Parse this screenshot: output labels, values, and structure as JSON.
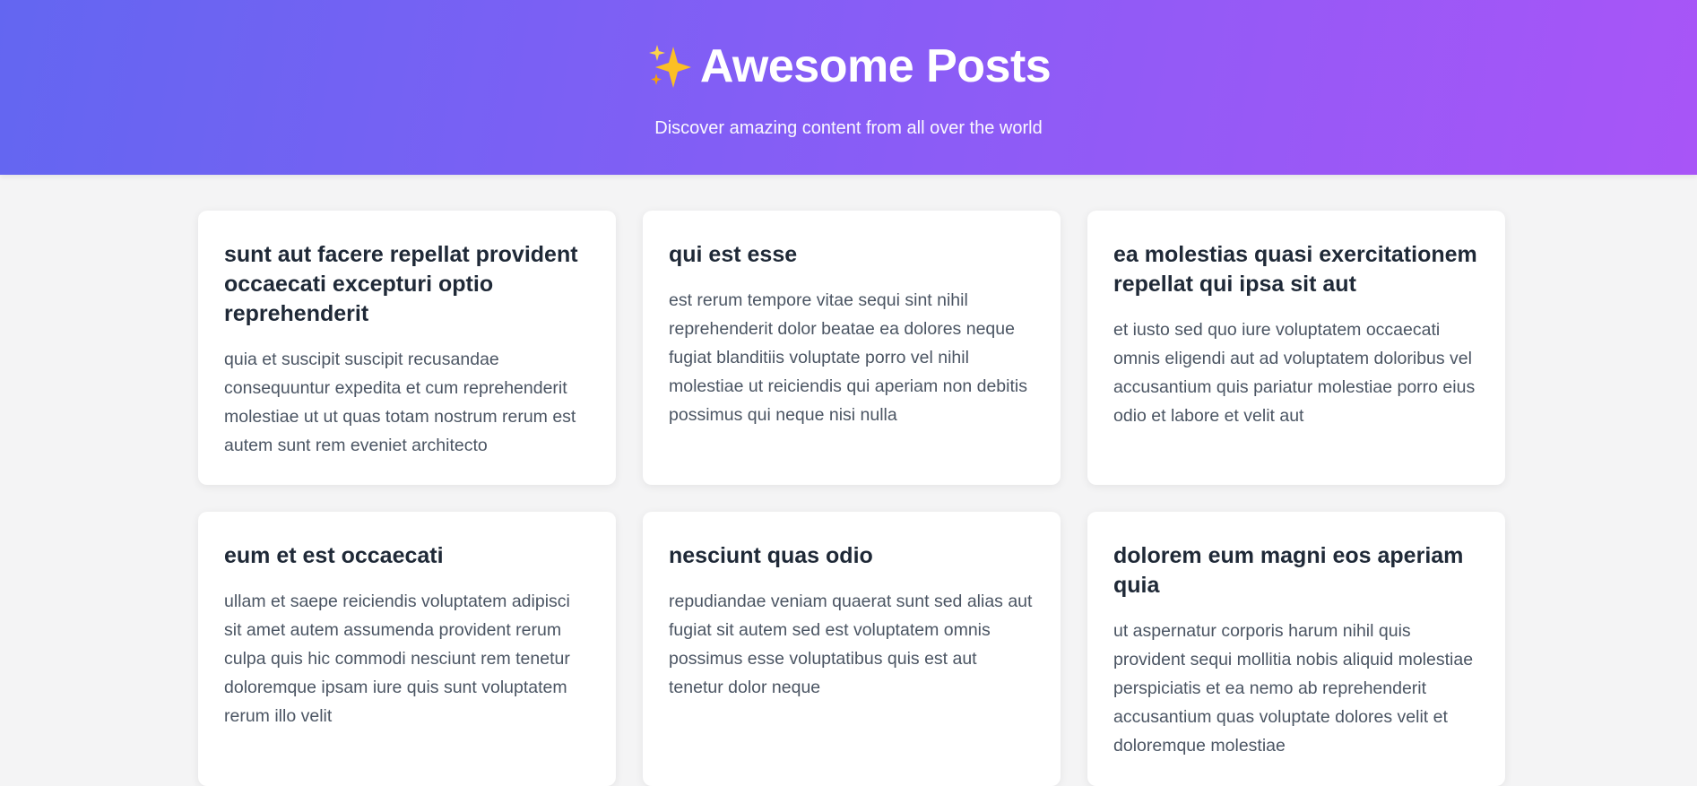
{
  "header": {
    "icon": "sparkles-icon",
    "title": "Awesome Posts",
    "subtitle": "Discover amazing content from all over the world"
  },
  "colors": {
    "gradient_start": "#6366f1",
    "gradient_end": "#a855f7",
    "page_background": "#f4f4f5",
    "card_background": "#ffffff",
    "title_text": "#1f2937",
    "body_text": "#4b5563"
  },
  "posts": [
    {
      "title": "sunt aut facere repellat provident occaecati excepturi optio reprehenderit",
      "body": "quia et suscipit suscipit recusandae consequuntur expedita et cum reprehenderit molestiae ut ut quas totam nostrum rerum est autem sunt rem eveniet architecto"
    },
    {
      "title": "qui est esse",
      "body": "est rerum tempore vitae sequi sint nihil reprehenderit dolor beatae ea dolores neque fugiat blanditiis voluptate porro vel nihil molestiae ut reiciendis qui aperiam non debitis possimus qui neque nisi nulla"
    },
    {
      "title": "ea molestias quasi exercitationem repellat qui ipsa sit aut",
      "body": "et iusto sed quo iure voluptatem occaecati omnis eligendi aut ad voluptatem doloribus vel accusantium quis pariatur molestiae porro eius odio et labore et velit aut"
    },
    {
      "title": "eum et est occaecati",
      "body": "ullam et saepe reiciendis voluptatem adipisci sit amet autem assumenda provident rerum culpa quis hic commodi nesciunt rem tenetur doloremque ipsam iure quis sunt voluptatem rerum illo velit"
    },
    {
      "title": "nesciunt quas odio",
      "body": "repudiandae veniam quaerat sunt sed alias aut fugiat sit autem sed est voluptatem omnis possimus esse voluptatibus quis est aut tenetur dolor neque"
    },
    {
      "title": "dolorem eum magni eos aperiam quia",
      "body": "ut aspernatur corporis harum nihil quis provident sequi mollitia nobis aliquid molestiae perspiciatis et ea nemo ab reprehenderit accusantium quas voluptate dolores velit et doloremque molestiae"
    }
  ]
}
